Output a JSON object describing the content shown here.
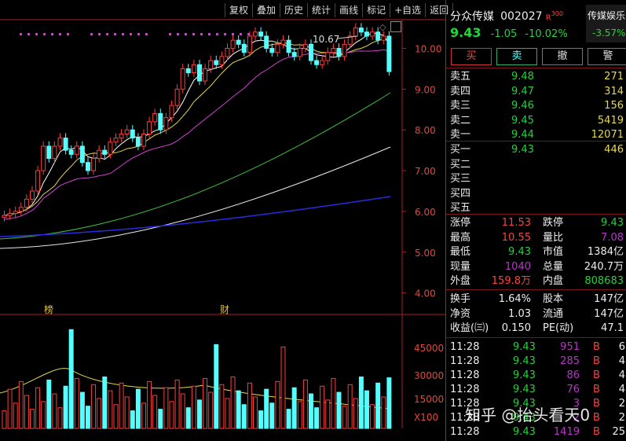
{
  "toolbar": [
    "复权",
    "叠加",
    "历史",
    "统计",
    "画线",
    "标记",
    "+自选",
    "返回"
  ],
  "header": {
    "name": "分众传媒",
    "code": "002027",
    "tag": "R",
    "tag2": "300",
    "price": "9.43",
    "change": "-1.05",
    "pct": "-10.02%",
    "sector": "传媒娱乐",
    "sector_pct": "-3.57%"
  },
  "actions": [
    "买",
    "卖",
    "撤",
    "警"
  ],
  "sell_book": [
    {
      "label": "卖五",
      "price": "9.48",
      "vol": "271"
    },
    {
      "label": "卖四",
      "price": "9.47",
      "vol": "314"
    },
    {
      "label": "卖三",
      "price": "9.46",
      "vol": "156"
    },
    {
      "label": "卖二",
      "price": "9.45",
      "vol": "5419"
    },
    {
      "label": "卖一",
      "price": "9.44",
      "vol": "12071"
    }
  ],
  "buy_book": [
    {
      "label": "买一",
      "price": "9.43",
      "vol": "446"
    },
    {
      "label": "买二",
      "price": "",
      "vol": ""
    },
    {
      "label": "买三",
      "price": "",
      "vol": ""
    },
    {
      "label": "买四",
      "price": "",
      "vol": ""
    },
    {
      "label": "买五",
      "price": "",
      "vol": ""
    }
  ],
  "stats": [
    {
      "l1": "涨停",
      "v1": "11.53",
      "l2": "跌停",
      "v2": "9.43"
    },
    {
      "l1": "最高",
      "v1": "10.55",
      "l2": "量比",
      "v2": "7.08"
    },
    {
      "l1": "最低",
      "v1": "9.43",
      "l2": "市值",
      "v2": "1384亿"
    },
    {
      "l1": "现量",
      "v1": "1040",
      "l2": "总量",
      "v2": "240.7万"
    },
    {
      "l1": "外盘",
      "v1": "159.8万",
      "l2": "内盘",
      "v2": "808683"
    }
  ],
  "stats2": [
    {
      "l1": "换手",
      "v1": "1.64%",
      "l2": "股本",
      "v2": "147亿"
    },
    {
      "l1": "净资",
      "v1": "1.03",
      "l2": "流通",
      "v2": "147亿"
    },
    {
      "l1": "收益(㈢)",
      "v1": "0.150",
      "l2": "PE(动)",
      "v2": "47.1"
    }
  ],
  "ticks": [
    {
      "t": "11:28",
      "p": "9.43",
      "v": "951",
      "d": "B",
      "n": "6"
    },
    {
      "t": "11:28",
      "p": "9.43",
      "v": "285",
      "d": "B",
      "n": "4"
    },
    {
      "t": "11:28",
      "p": "9.43",
      "v": "86",
      "d": "B",
      "n": "4"
    },
    {
      "t": "11:28",
      "p": "9.43",
      "v": "76",
      "d": "B",
      "n": "4"
    },
    {
      "t": "11:28",
      "p": "9.43",
      "v": "3",
      "d": "B",
      "n": "2"
    },
    {
      "t": "11:28",
      "p": "9.43",
      "v": "2",
      "d": "B",
      "n": "2"
    },
    {
      "t": "11:28",
      "p": "9.43",
      "v": "1419",
      "d": "B",
      "n": "25"
    }
  ],
  "chart_labels": {
    "price_axis": [
      "10.00",
      "9.00",
      "8.00",
      "7.00",
      "6.00",
      "5.00",
      "4.00"
    ],
    "vol_axis": [
      "45000",
      "30000",
      "15000",
      "X100"
    ],
    "peak": "10.67",
    "mark1": "榜",
    "mark2": "财"
  },
  "watermark": "知乎 @抬头看天0",
  "colors": {
    "up": "#ff3c3c",
    "down": "#54ffff",
    "bg": "#000000"
  }
}
